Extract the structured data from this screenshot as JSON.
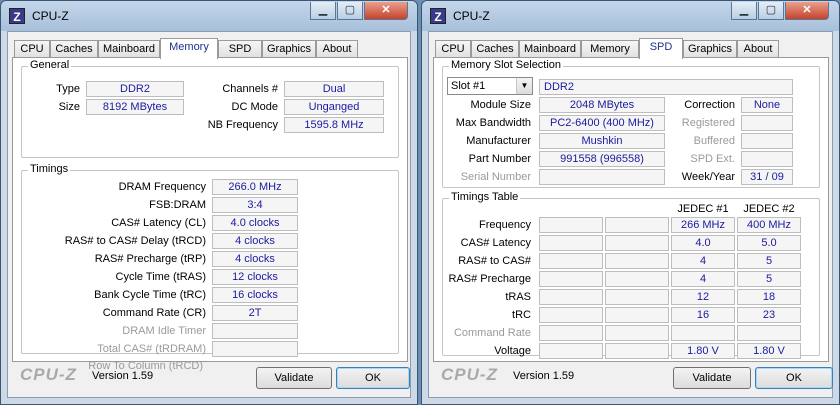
{
  "window1": {
    "title": "CPU-Z",
    "tabs": [
      "CPU",
      "Caches",
      "Mainboard",
      "Memory",
      "SPD",
      "Graphics",
      "About"
    ],
    "active_tab": "Memory",
    "general": {
      "label": "General",
      "type_label": "Type",
      "type_value": "DDR2",
      "size_label": "Size",
      "size_value": "8192 MBytes",
      "channels_label": "Channels #",
      "channels_value": "Dual",
      "dcmode_label": "DC Mode",
      "dcmode_value": "Unganged",
      "nbfreq_label": "NB Frequency",
      "nbfreq_value": "1595.8 MHz"
    },
    "timings": {
      "label": "Timings",
      "rows": [
        {
          "label": "DRAM Frequency",
          "value": "266.0 MHz",
          "enabled": true
        },
        {
          "label": "FSB:DRAM",
          "value": "3:4",
          "enabled": true
        },
        {
          "label": "CAS# Latency (CL)",
          "value": "4.0 clocks",
          "enabled": true
        },
        {
          "label": "RAS# to CAS# Delay (tRCD)",
          "value": "4 clocks",
          "enabled": true
        },
        {
          "label": "RAS# Precharge (tRP)",
          "value": "4 clocks",
          "enabled": true
        },
        {
          "label": "Cycle Time (tRAS)",
          "value": "12 clocks",
          "enabled": true
        },
        {
          "label": "Bank Cycle Time (tRC)",
          "value": "16 clocks",
          "enabled": true
        },
        {
          "label": "Command Rate (CR)",
          "value": "2T",
          "enabled": true
        },
        {
          "label": "DRAM Idle Timer",
          "value": "",
          "enabled": false
        },
        {
          "label": "Total CAS# (tRDRAM)",
          "value": "",
          "enabled": false
        },
        {
          "label": "Row To Column (tRCD)",
          "value": "",
          "enabled": false
        }
      ]
    },
    "footer": {
      "logo": "CPU-Z",
      "version": "Version 1.59",
      "validate": "Validate",
      "ok": "OK"
    }
  },
  "window2": {
    "title": "CPU-Z",
    "tabs": [
      "CPU",
      "Caches",
      "Mainboard",
      "Memory",
      "SPD",
      "Graphics",
      "About"
    ],
    "active_tab": "SPD",
    "slot": {
      "label": "Memory Slot Selection",
      "selected": "Slot #1",
      "type_value": "DDR2",
      "module_size_label": "Module Size",
      "module_size_value": "2048 MBytes",
      "max_bw_label": "Max Bandwidth",
      "max_bw_value": "PC2-6400 (400 MHz)",
      "manufacturer_label": "Manufacturer",
      "manufacturer_value": "Mushkin",
      "part_label": "Part Number",
      "part_value": "991558 (996558)",
      "serial_label": "Serial Number",
      "serial_value": "",
      "correction_label": "Correction",
      "correction_value": "None",
      "registered_label": "Registered",
      "registered_value": "",
      "buffered_label": "Buffered",
      "buffered_value": "",
      "spdext_label": "SPD Ext.",
      "spdext_value": "",
      "weekyear_label": "Week/Year",
      "weekyear_value": "31 / 09"
    },
    "timings_table": {
      "label": "Timings Table",
      "columns": [
        "",
        "",
        "JEDEC #1",
        "JEDEC #2"
      ],
      "rows": [
        {
          "label": "Frequency",
          "enabled": true,
          "cells": [
            "",
            "",
            "266 MHz",
            "400 MHz"
          ]
        },
        {
          "label": "CAS# Latency",
          "enabled": true,
          "cells": [
            "",
            "",
            "4.0",
            "5.0"
          ]
        },
        {
          "label": "RAS# to CAS#",
          "enabled": true,
          "cells": [
            "",
            "",
            "4",
            "5"
          ]
        },
        {
          "label": "RAS# Precharge",
          "enabled": true,
          "cells": [
            "",
            "",
            "4",
            "5"
          ]
        },
        {
          "label": "tRAS",
          "enabled": true,
          "cells": [
            "",
            "",
            "12",
            "18"
          ]
        },
        {
          "label": "tRC",
          "enabled": true,
          "cells": [
            "",
            "",
            "16",
            "23"
          ]
        },
        {
          "label": "Command Rate",
          "enabled": false,
          "cells": [
            "",
            "",
            "",
            ""
          ]
        },
        {
          "label": "Voltage",
          "enabled": true,
          "cells": [
            "",
            "",
            "1.80 V",
            "1.80 V"
          ]
        }
      ]
    },
    "footer": {
      "logo": "CPU-Z",
      "version": "Version 1.59",
      "validate": "Validate",
      "ok": "OK"
    }
  },
  "colors": {
    "value_text": "#1a1a9e",
    "active_tab_text": "#1f2f8f",
    "disabled_text": "#9a9a9a",
    "close_button": "#c4432a"
  }
}
